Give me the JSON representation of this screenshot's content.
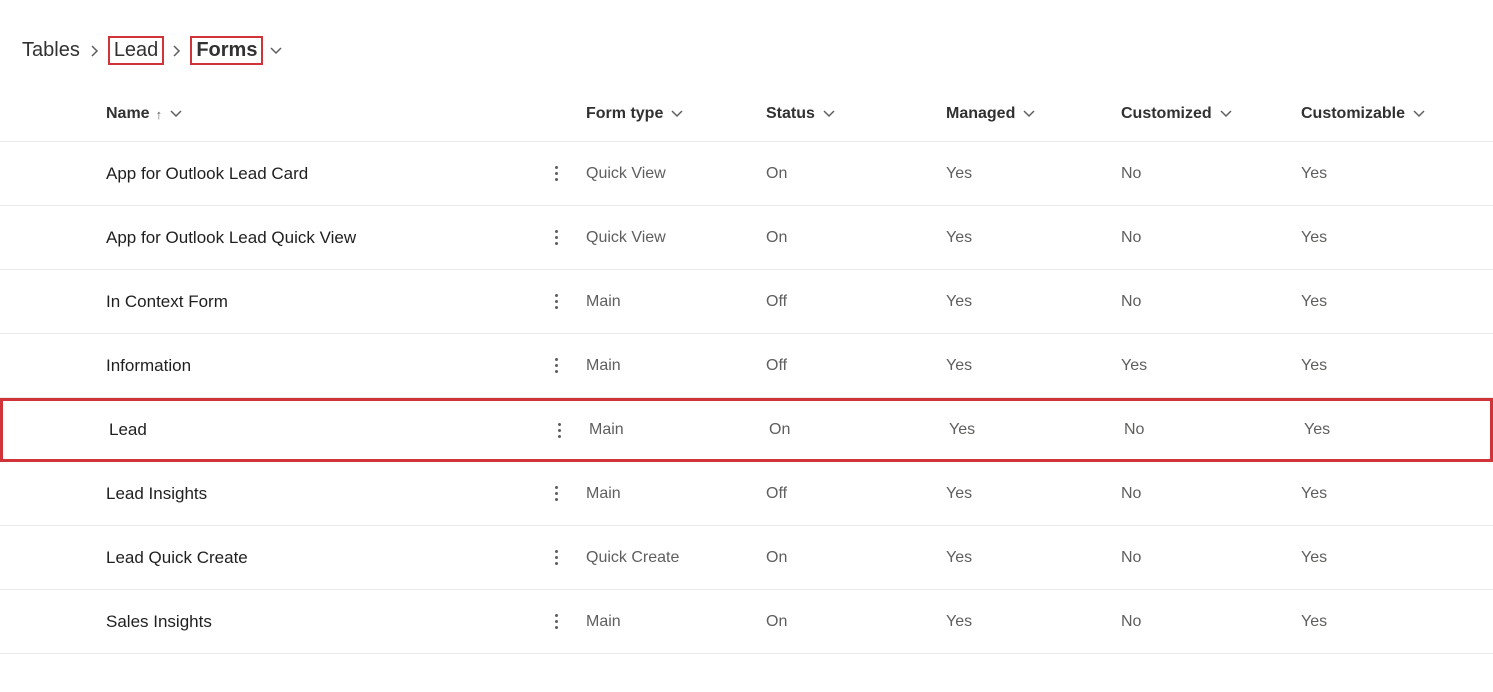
{
  "breadcrumb": {
    "tables": "Tables",
    "lead": "Lead",
    "forms": "Forms"
  },
  "headers": {
    "name": "Name",
    "form_type": "Form type",
    "status": "Status",
    "managed": "Managed",
    "customized": "Customized",
    "customizable": "Customizable"
  },
  "rows": [
    {
      "name": "App for Outlook Lead Card",
      "form_type": "Quick View",
      "status": "On",
      "managed": "Yes",
      "customized": "No",
      "customizable": "Yes"
    },
    {
      "name": "App for Outlook Lead Quick View",
      "form_type": "Quick View",
      "status": "On",
      "managed": "Yes",
      "customized": "No",
      "customizable": "Yes"
    },
    {
      "name": "In Context Form",
      "form_type": "Main",
      "status": "Off",
      "managed": "Yes",
      "customized": "No",
      "customizable": "Yes"
    },
    {
      "name": "Information",
      "form_type": "Main",
      "status": "Off",
      "managed": "Yes",
      "customized": "Yes",
      "customizable": "Yes"
    },
    {
      "name": "Lead",
      "form_type": "Main",
      "status": "On",
      "managed": "Yes",
      "customized": "No",
      "customizable": "Yes"
    },
    {
      "name": "Lead Insights",
      "form_type": "Main",
      "status": "Off",
      "managed": "Yes",
      "customized": "No",
      "customizable": "Yes"
    },
    {
      "name": "Lead Quick Create",
      "form_type": "Quick Create",
      "status": "On",
      "managed": "Yes",
      "customized": "No",
      "customizable": "Yes"
    },
    {
      "name": "Sales Insights",
      "form_type": "Main",
      "status": "On",
      "managed": "Yes",
      "customized": "No",
      "customizable": "Yes"
    }
  ]
}
